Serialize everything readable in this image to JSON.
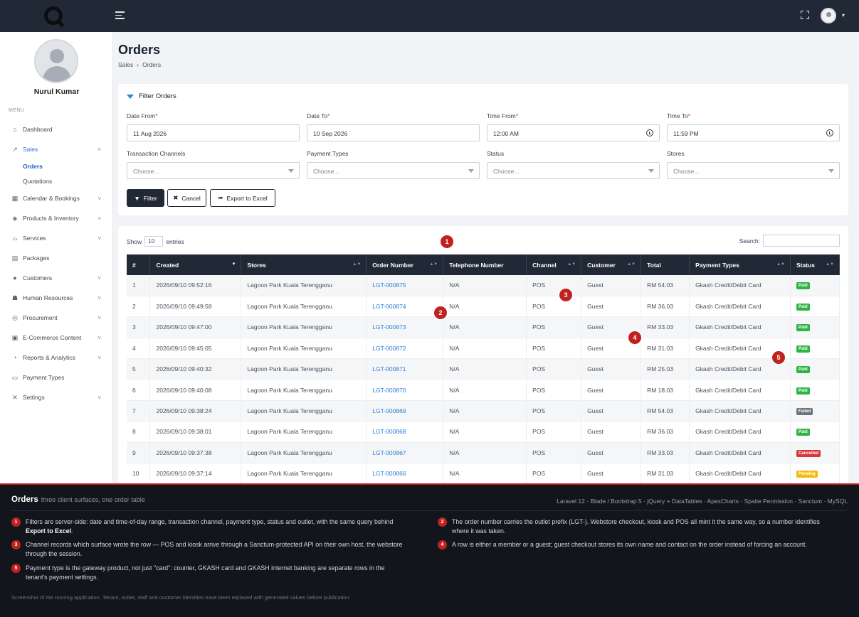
{
  "user": {
    "name": "Nurul Kumar"
  },
  "sidebar": {
    "menu_label": "MENU",
    "items": [
      {
        "label": "Dashboard",
        "icon": "home-icon"
      },
      {
        "label": "Sales",
        "icon": "chart-line-icon"
      },
      {
        "label": "Calendar & Bookings",
        "icon": "calendar-icon"
      },
      {
        "label": "Products & Inventory",
        "icon": "box-icon"
      },
      {
        "label": "Services",
        "icon": "bell-icon"
      },
      {
        "label": "Packages",
        "icon": "boxes-icon"
      },
      {
        "label": "Customers",
        "icon": "user-circle-icon"
      },
      {
        "label": "Human Resources",
        "icon": "users-icon"
      },
      {
        "label": "Procurement",
        "icon": "coins-icon"
      },
      {
        "label": "E-Commerce Content",
        "icon": "window-icon"
      },
      {
        "label": "Reports & Analytics",
        "icon": "pie-chart-icon"
      },
      {
        "label": "Payment Types",
        "icon": "credit-card-icon"
      },
      {
        "label": "Settings",
        "icon": "tools-icon"
      }
    ],
    "sales_sub": [
      "Orders",
      "Quotations"
    ]
  },
  "page": {
    "title": "Orders",
    "breadcrumb": [
      "Sales",
      "›",
      "Orders"
    ]
  },
  "filter": {
    "title": "Filter Orders",
    "date_from": {
      "label": "Date From",
      "value": "11 Aug 2026"
    },
    "date_to": {
      "label": "Date To",
      "value": "10 Sep 2026"
    },
    "time_from": {
      "label": "Time From",
      "value": "12:00 AM"
    },
    "time_to": {
      "label": "Time To",
      "value": "11:59 PM"
    },
    "channels": {
      "label": "Transaction Channels",
      "value": "Choose..."
    },
    "payment_types": {
      "label": "Payment Types",
      "value": "Choose..."
    },
    "status": {
      "label": "Status",
      "value": "Choose..."
    },
    "stores": {
      "label": "Stores",
      "value": "Choose..."
    },
    "required_mark": "*",
    "buttons": {
      "filter": "Filter",
      "cancel": "Cancel",
      "export": "Export to Excel"
    }
  },
  "table": {
    "show_label": "Show",
    "entries_value": "10",
    "entries_label": "entries",
    "search_label": "Search:",
    "columns": [
      "#",
      "Created",
      "Stores",
      "Order Number",
      "Telephone Number",
      "Channel",
      "Customer",
      "Total",
      "Payment Types",
      "Status"
    ],
    "rows": [
      {
        "n": "1",
        "created": "2026/09/10 09:52:16",
        "store": "Lagoon Park Kuala Terengganu",
        "order": "LGT-000875",
        "tel": "N/A",
        "channel": "POS",
        "customer": "Guest",
        "total": "RM 54.03",
        "payment": "Gkash Credit/Debit Card",
        "status": "Paid"
      },
      {
        "n": "2",
        "created": "2026/09/10 09:49:58",
        "store": "Lagoon Park Kuala Terengganu",
        "order": "LGT-000874",
        "tel": "N/A",
        "channel": "POS",
        "customer": "Guest",
        "total": "RM 36.03",
        "payment": "Gkash Credit/Debit Card",
        "status": "Paid"
      },
      {
        "n": "3",
        "created": "2026/09/10 09:47:00",
        "store": "Lagoon Park Kuala Terengganu",
        "order": "LGT-000873",
        "tel": "N/A",
        "channel": "POS",
        "customer": "Guest",
        "total": "RM 33.03",
        "payment": "Gkash Credit/Debit Card",
        "status": "Paid"
      },
      {
        "n": "4",
        "created": "2026/09/10 09:45:05",
        "store": "Lagoon Park Kuala Terengganu",
        "order": "LGT-000872",
        "tel": "N/A",
        "channel": "POS",
        "customer": "Guest",
        "total": "RM 31.03",
        "payment": "Gkash Credit/Debit Card",
        "status": "Paid"
      },
      {
        "n": "5",
        "created": "2026/09/10 09:40:32",
        "store": "Lagoon Park Kuala Terengganu",
        "order": "LGT-000871",
        "tel": "N/A",
        "channel": "POS",
        "customer": "Guest",
        "total": "RM 25.03",
        "payment": "Gkash Credit/Debit Card",
        "status": "Paid"
      },
      {
        "n": "6",
        "created": "2026/09/10 09:40:08",
        "store": "Lagoon Park Kuala Terengganu",
        "order": "LGT-000870",
        "tel": "N/A",
        "channel": "POS",
        "customer": "Guest",
        "total": "RM 18.03",
        "payment": "Gkash Credit/Debit Card",
        "status": "Paid"
      },
      {
        "n": "7",
        "created": "2026/09/10 09:38:24",
        "store": "Lagoon Park Kuala Terengganu",
        "order": "LGT-000869",
        "tel": "N/A",
        "channel": "POS",
        "customer": "Guest",
        "total": "RM 54.03",
        "payment": "Gkash Credit/Debit Card",
        "status": "Failed"
      },
      {
        "n": "8",
        "created": "2026/09/10 09:38:01",
        "store": "Lagoon Park Kuala Terengganu",
        "order": "LGT-000868",
        "tel": "N/A",
        "channel": "POS",
        "customer": "Guest",
        "total": "RM 36.03",
        "payment": "Gkash Credit/Debit Card",
        "status": "Paid"
      },
      {
        "n": "9",
        "created": "2026/09/10 09:37:38",
        "store": "Lagoon Park Kuala Terengganu",
        "order": "LGT-000867",
        "tel": "N/A",
        "channel": "POS",
        "customer": "Guest",
        "total": "RM 33.03",
        "payment": "Gkash Credit/Debit Card",
        "status": "Cancelled"
      },
      {
        "n": "10",
        "created": "2026/09/10 09:37:14",
        "store": "Lagoon Park Kuala Terengganu",
        "order": "LGT-000866",
        "tel": "N/A",
        "channel": "POS",
        "customer": "Guest",
        "total": "RM 31.03",
        "payment": "Gkash Credit/Debit Card",
        "status": "Pending"
      }
    ]
  },
  "status_colors": {
    "Paid": "#2fb344",
    "Failed": "#6c757d",
    "Cancelled": "#d63939",
    "Pending": "#f5b90c"
  },
  "markers": [
    "1",
    "2",
    "3",
    "4",
    "5"
  ],
  "footer": {
    "title": "Orders",
    "subtitle": "three client surfaces, one order table",
    "stack": "Laravel 12 · Blade / Bootstrap 5 · jQuery + DataTables · ApexCharts · Spatie Permission · Sanctum · MySQL",
    "notes": [
      {
        "n": "1",
        "text": "Filters are server-side: date and time-of-day range, transaction channel, payment type, status and outlet, with the same query behind",
        "bold": "Export to Excel",
        "tail": "."
      },
      {
        "n": "2",
        "text": "The order number carries the outlet prefix (LGT-). Webstore checkout, kiosk and POS all mint it the same way, so a number identifies where it was taken.",
        "bold": "",
        "tail": ""
      },
      {
        "n": "3",
        "text": "Channel records which surface wrote the row — POS and kiosk arrive through a Sanctum-protected API on their own host, the webstore through the session.",
        "bold": "",
        "tail": ""
      },
      {
        "n": "4",
        "text": "A row is either a member or a guest; guest checkout stores its own name and contact on the order instead of forcing an account.",
        "bold": "",
        "tail": ""
      },
      {
        "n": "5",
        "text": "Payment type is the gateway product, not just \"card\": counter, GKASH card and GKASH internet banking are separate rows in the tenant's payment settings.",
        "bold": "",
        "tail": ""
      }
    ],
    "fine_print": "Screenshot of the running application. Tenant, outlet, staff and customer identities have been replaced with generated values before publication."
  }
}
